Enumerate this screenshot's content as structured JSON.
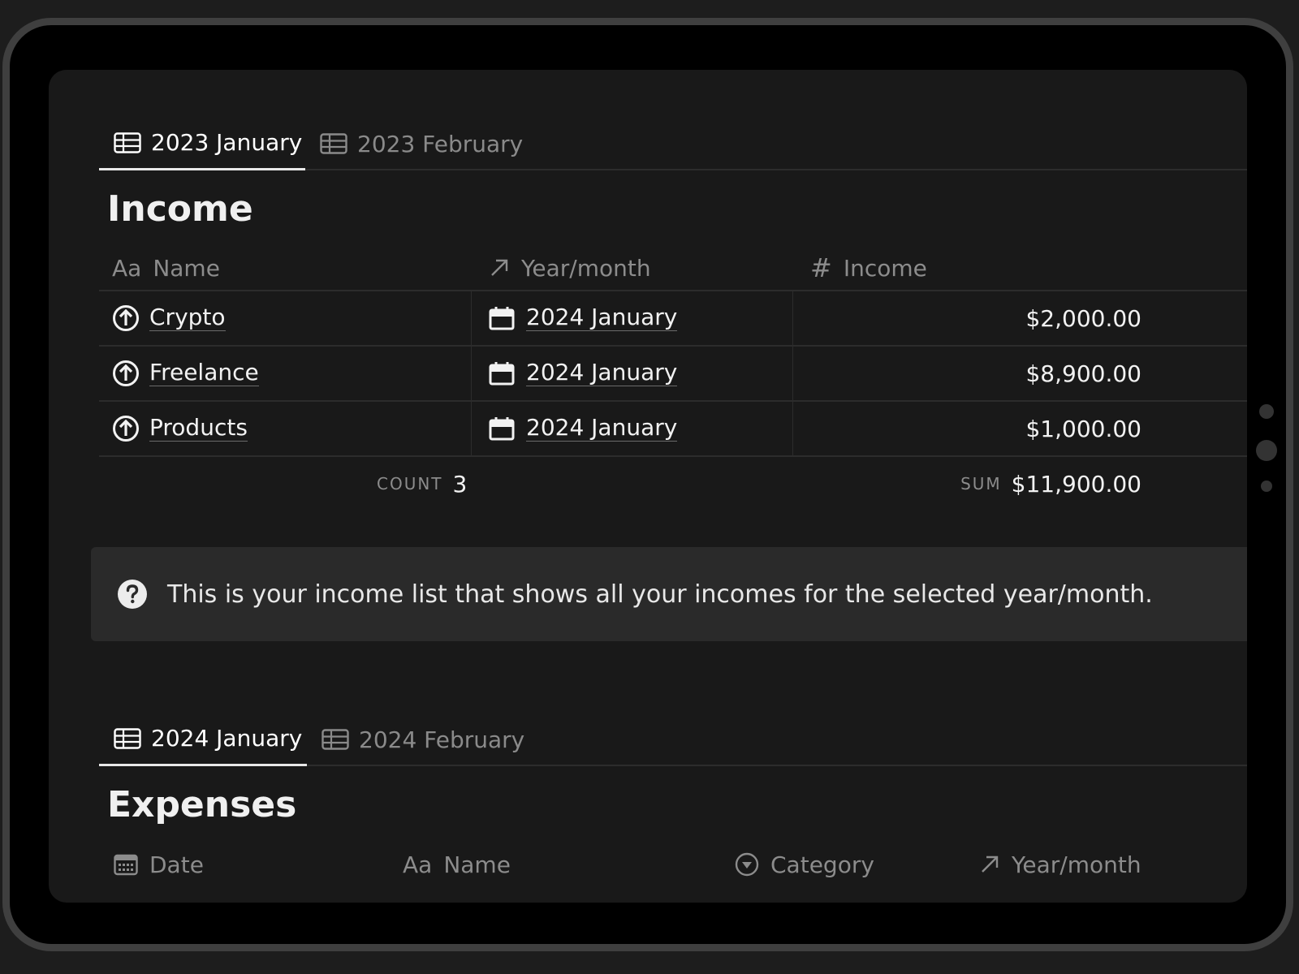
{
  "income_section": {
    "tabs": [
      {
        "label": "2023 January",
        "active": true
      },
      {
        "label": "2023 February",
        "active": false
      }
    ],
    "title": "Income",
    "columns": {
      "name": {
        "prefix": "Aa",
        "label": "Name"
      },
      "year_month": {
        "label": "Year/month"
      },
      "income": {
        "label": "Income"
      }
    },
    "rows": [
      {
        "name": "Crypto",
        "year_month": "2024 January",
        "income": "$2,000.00"
      },
      {
        "name": "Freelance",
        "year_month": "2024 January",
        "income": "$8,900.00"
      },
      {
        "name": "Products",
        "year_month": "2024 January",
        "income": "$1,000.00"
      }
    ],
    "footer": {
      "count_label": "COUNT",
      "count_value": "3",
      "sum_label": "SUM",
      "sum_value": "$11,900.00"
    }
  },
  "callout": {
    "icon": "question-circle-icon",
    "text": "This is your income list that shows all your incomes for the selected year/month."
  },
  "expenses_section": {
    "tabs": [
      {
        "label": "2024 January",
        "active": true
      },
      {
        "label": "2024 February",
        "active": false
      }
    ],
    "title": "Expenses",
    "columns": {
      "date": {
        "label": "Date"
      },
      "name": {
        "prefix": "Aa",
        "label": "Name"
      },
      "category": {
        "label": "Category"
      },
      "year_month": {
        "label": "Year/month"
      }
    }
  },
  "colors": {
    "background": "#191919",
    "frame": "#3f3f3f",
    "text_primary": "#f2f2f2",
    "text_muted": "#8c8c8c",
    "callout_bg": "#2a2a2a"
  }
}
